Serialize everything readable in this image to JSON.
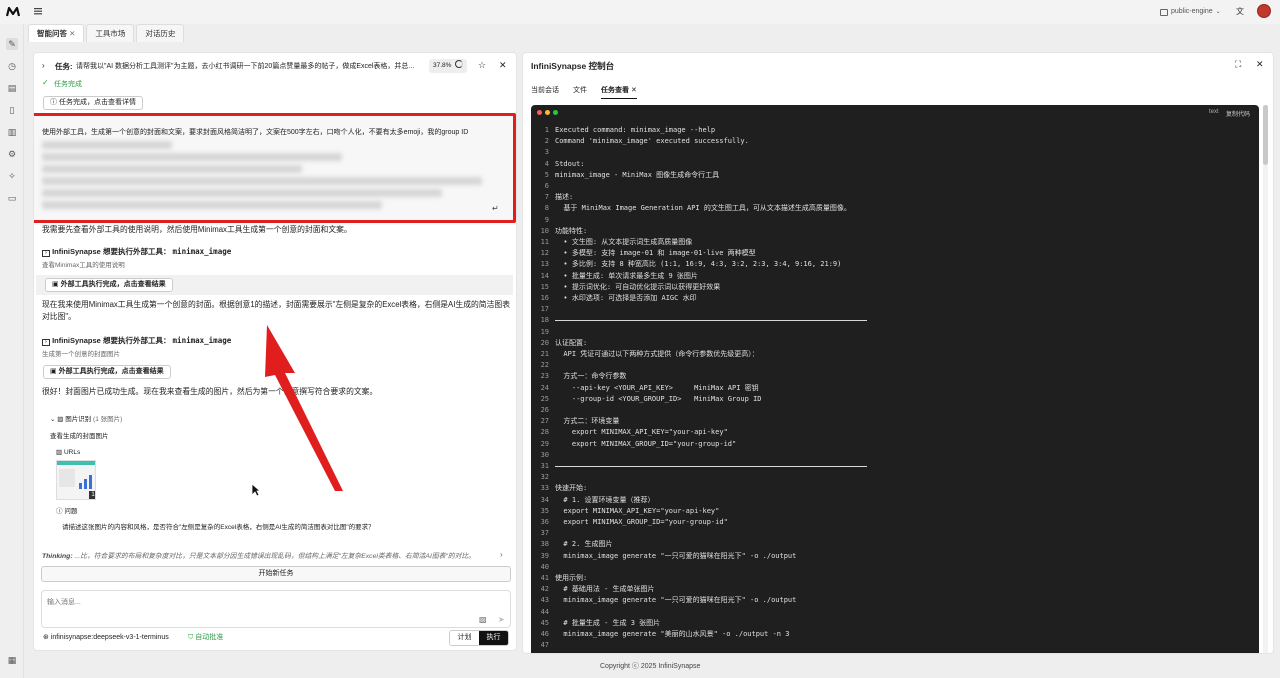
{
  "topbar": {
    "engine_label": "public-engine",
    "translate_icon": "translate-icon",
    "avatar_icon": "avatar"
  },
  "tabs": [
    {
      "label": "智能问答"
    },
    {
      "label": "工具市场"
    },
    {
      "label": "对话历史"
    }
  ],
  "task": {
    "prefix": "任务:",
    "text": "请帮我以\"AI 数据分析工具测评\"为主题，去小红书调研一下前20篇点赞量最多的帖子，做成Excel表格，并总...",
    "progress": "37.8%",
    "status": "任务完成",
    "details_button": "任务完成，点击查看详情"
  },
  "prompt_box": {
    "text": "使用外部工具，生成第一个创意的封面和文案，要求封面风格简洁明了，文案在500字左右，口吻个人化，不要有太多emoji，我的group ID"
  },
  "messages": {
    "m1": "我需要先查看外部工具的使用说明，然后使用Minimax工具生成第一个创意的封面和文案。",
    "tool1_title": "InfiniSynapse 想要执行外部工具：",
    "tool1_name": "minimax_image",
    "tool1_desc": "查看Minimax工具的使用说明",
    "tool1_result": "外部工具执行完成，点击查看结果",
    "m2": "现在我来使用Minimax工具生成第一个创意的封面。根据创意1的描述，封面需要展示\"左侧是复杂的Excel表格，右侧是AI生成的简洁图表对比图\"。",
    "tool2_title": "InfiniSynapse 想要执行外部工具：",
    "tool2_name": "minimax_image",
    "tool2_desc": "生成第一个创意的封面图片",
    "tool2_result": "外部工具执行完成，点击查看结果",
    "m3": "很好！封面图片已成功生成。现在我来查看生成的图片，然后为第一个创意撰写符合要求的文案。",
    "img_section": "图片识别",
    "img_count": "(1 张图片)",
    "img_desc": "查看生成的封面图片",
    "urls_label": "URLs",
    "thumb_badge": "1",
    "question_label": "问题",
    "question_text": "请描述这张图片的内容和风格，是否符合\"左侧是复杂的Excel表格，右侧是AI生成的简洁图表对比图\"的要求？",
    "thinking_label": "Thinking:",
    "thinking_text": "...比，符合要求的布局和复杂度对比，只是文本部分因生成错误出现乱码，但结构上满足\"左复杂Excel类表格、右简洁AI图表\"的对比。"
  },
  "composer": {
    "new_task": "开始新任务",
    "placeholder": "输入消息...",
    "model": "infinisynapse:deepseek-v3-1-terminus",
    "auto_approve": "自动批准",
    "plan": "计划",
    "execute": "执行"
  },
  "console": {
    "title": "InfiniSynapse 控制台",
    "tabs": [
      {
        "label": "当前会话"
      },
      {
        "label": "文件"
      },
      {
        "label": "任务查看"
      }
    ],
    "term_mode": "text",
    "copy_code": "复制代码",
    "lines": [
      {
        "n": "1",
        "t": "Executed command: minimax_image --help"
      },
      {
        "n": "2",
        "t": "Command 'minimax_image' executed successfully."
      },
      {
        "n": "3",
        "t": ""
      },
      {
        "n": "4",
        "t": "Stdout:"
      },
      {
        "n": "5",
        "t": "minimax_image - MiniMax 图像生成命令行工具"
      },
      {
        "n": "6",
        "t": ""
      },
      {
        "n": "7",
        "t": "描述:"
      },
      {
        "n": "8",
        "t": "  基于 MiniMax Image Generation API 的文生图工具，可从文本描述生成高质量图像。"
      },
      {
        "n": "9",
        "t": ""
      },
      {
        "n": "10",
        "t": "功能特性:"
      },
      {
        "n": "11",
        "t": "  • 文生图: 从文本提示词生成高质量图像"
      },
      {
        "n": "12",
        "t": "  • 多模型: 支持 image-01 和 image-01-live 两种模型"
      },
      {
        "n": "13",
        "t": "  • 多比例: 支持 8 种宽高比 (1:1, 16:9, 4:3, 3:2, 2:3, 3:4, 9:16, 21:9)"
      },
      {
        "n": "14",
        "t": "  • 批量生成: 单次请求最多生成 9 张图片"
      },
      {
        "n": "15",
        "t": "  • 提示词优化: 可自动优化提示词以获得更好效果"
      },
      {
        "n": "16",
        "t": "  • 水印选项: 可选择是否添加 AIGC 水印"
      },
      {
        "n": "17",
        "t": ""
      },
      {
        "n": "18",
        "t": "SEP"
      },
      {
        "n": "19",
        "t": ""
      },
      {
        "n": "20",
        "t": "认证配置:"
      },
      {
        "n": "21",
        "t": "  API 凭证可通过以下两种方式提供（命令行参数优先级更高）："
      },
      {
        "n": "22",
        "t": ""
      },
      {
        "n": "23",
        "t": "  方式一：命令行参数"
      },
      {
        "n": "24",
        "t": "    --api-key <YOUR_API_KEY>     MiniMax API 密钥"
      },
      {
        "n": "25",
        "t": "    --group-id <YOUR_GROUP_ID>   MiniMax Group ID"
      },
      {
        "n": "26",
        "t": ""
      },
      {
        "n": "27",
        "t": "  方式二：环境变量"
      },
      {
        "n": "28",
        "t": "    export MINIMAX_API_KEY=\"your-api-key\""
      },
      {
        "n": "29",
        "t": "    export MINIMAX_GROUP_ID=\"your-group-id\""
      },
      {
        "n": "30",
        "t": ""
      },
      {
        "n": "31",
        "t": "SEP"
      },
      {
        "n": "32",
        "t": ""
      },
      {
        "n": "33",
        "t": "快速开始:"
      },
      {
        "n": "34",
        "t": "  # 1. 设置环境变量（推荐）"
      },
      {
        "n": "35",
        "t": "  export MINIMAX_API_KEY=\"your-api-key\""
      },
      {
        "n": "36",
        "t": "  export MINIMAX_GROUP_ID=\"your-group-id\""
      },
      {
        "n": "37",
        "t": ""
      },
      {
        "n": "38",
        "t": "  # 2. 生成图片"
      },
      {
        "n": "39",
        "t": "  minimax_image generate \"一只可爱的猫咪在阳光下\" -o ./output"
      },
      {
        "n": "40",
        "t": ""
      },
      {
        "n": "41",
        "t": "使用示例:"
      },
      {
        "n": "42",
        "t": "  # 基础用法 - 生成单张图片"
      },
      {
        "n": "43",
        "t": "  minimax_image generate \"一只可爱的猫咪在阳光下\" -o ./output"
      },
      {
        "n": "44",
        "t": ""
      },
      {
        "n": "45",
        "t": "  # 批量生成 - 生成 3 张图片"
      },
      {
        "n": "46",
        "t": "  minimax_image generate \"美丽的山水风景\" -o ./output -n 3"
      },
      {
        "n": "47",
        "t": ""
      }
    ]
  },
  "footer": {
    "copyright": "Copyright ⓒ 2025 InfiniSynapse"
  },
  "colors": {
    "highlight_red": "#e01e1e",
    "terminal_bg": "#1f1f1f",
    "success_green": "#2e9e44"
  }
}
